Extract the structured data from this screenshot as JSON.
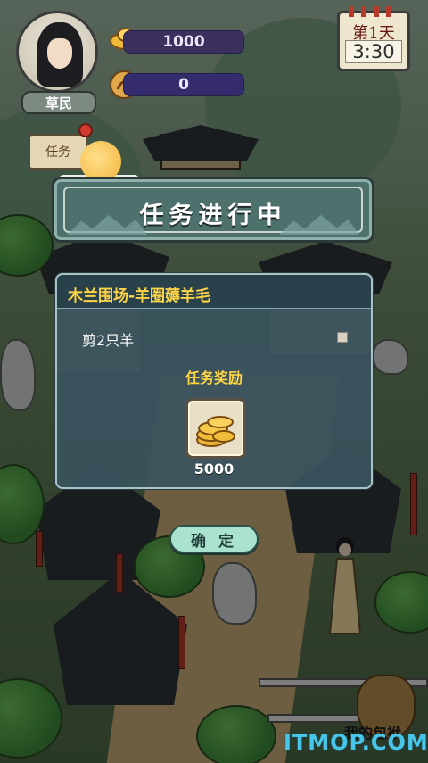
{
  "hud": {
    "rank": "草民",
    "gold_value": "1000",
    "exp_value": "0",
    "day_label": "第1天",
    "time": "3:30",
    "quest_scroll_label": "任务"
  },
  "dialog": {
    "title": "任务进行中",
    "quest_name": "木兰围场-羊圈薅羊毛",
    "task": "剪2只羊",
    "reward_label": "任务奖励",
    "reward_amount": "5000",
    "confirm_label": "确 定"
  },
  "decor": {
    "pouch_label": "我的包袱"
  },
  "watermark": "ITMOP.COM",
  "colors": {
    "accent_gold": "#ffd548",
    "panel_bg": "#3a545e",
    "confirm_bg": "#a9e3d0",
    "watermark": "#48c6ea"
  },
  "icons": [
    "ingot-icon",
    "token-icon",
    "coin-stack-icon",
    "check-box-icon"
  ]
}
